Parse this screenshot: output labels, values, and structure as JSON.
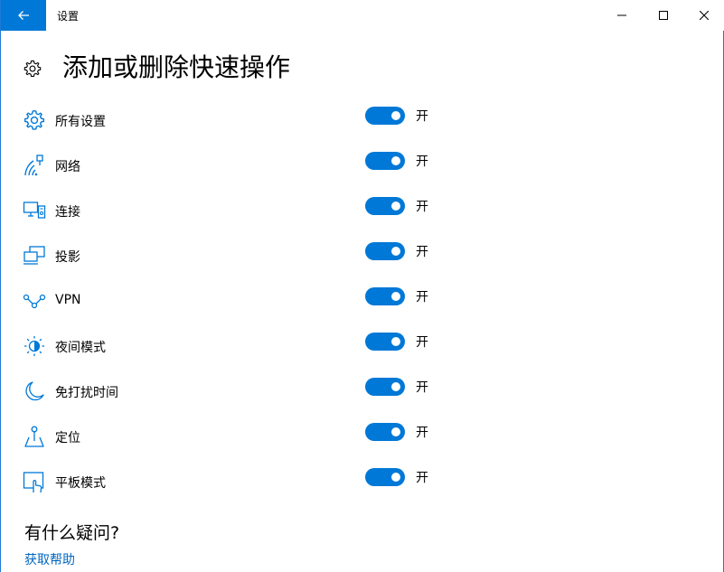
{
  "window": {
    "title": "设置",
    "accent": "#0078d7",
    "back_icon": "back-arrow-icon",
    "minimize_icon": "minimize-icon",
    "maximize_icon": "maximize-icon",
    "close_icon": "close-icon"
  },
  "page": {
    "icon": "gear-icon",
    "title": "添加或删除快速操作"
  },
  "quick_actions": [
    {
      "icon": "settings-gear-icon",
      "label": "所有设置",
      "state": "开",
      "on": true
    },
    {
      "icon": "network-icon",
      "label": "网络",
      "state": "开",
      "on": true
    },
    {
      "icon": "connect-icon",
      "label": "连接",
      "state": "开",
      "on": true
    },
    {
      "icon": "project-icon",
      "label": "投影",
      "state": "开",
      "on": true
    },
    {
      "icon": "vpn-icon",
      "label": "VPN",
      "state": "开",
      "on": true
    },
    {
      "icon": "night-light-icon",
      "label": "夜间模式",
      "state": "开",
      "on": true
    },
    {
      "icon": "focus-assist-moon-icon",
      "label": "免打扰时间",
      "state": "开",
      "on": true
    },
    {
      "icon": "location-icon",
      "label": "定位",
      "state": "开",
      "on": true
    },
    {
      "icon": "tablet-mode-icon",
      "label": "平板模式",
      "state": "开",
      "on": true
    }
  ],
  "help": {
    "heading": "有什么疑问?",
    "link": "获取帮助"
  }
}
